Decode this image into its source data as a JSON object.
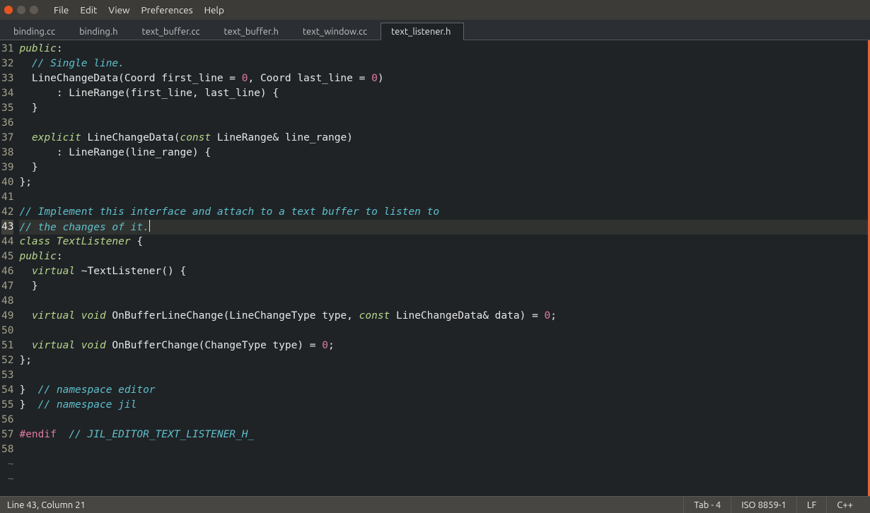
{
  "menu": [
    "File",
    "Edit",
    "View",
    "Preferences",
    "Help"
  ],
  "tabs": [
    {
      "label": "binding.cc",
      "active": false
    },
    {
      "label": "binding.h",
      "active": false
    },
    {
      "label": "text_buffer.cc",
      "active": false
    },
    {
      "label": "text_buffer.h",
      "active": false
    },
    {
      "label": "text_window.cc",
      "active": false
    },
    {
      "label": "text_listener.h",
      "active": true
    }
  ],
  "first_line_no": 31,
  "active_line_no": 43,
  "lines": [
    [
      [
        "keyword",
        "public"
      ],
      [
        "plain",
        ":"
      ]
    ],
    [
      [
        "plain",
        "  "
      ],
      [
        "comment",
        "// Single line."
      ]
    ],
    [
      [
        "plain",
        "  LineChangeData(Coord first_line = "
      ],
      [
        "number",
        "0"
      ],
      [
        "plain",
        ", Coord last_line = "
      ],
      [
        "number",
        "0"
      ],
      [
        "plain",
        ")"
      ]
    ],
    [
      [
        "plain",
        "      : LineRange(first_line, last_line) {"
      ]
    ],
    [
      [
        "plain",
        "  }"
      ]
    ],
    [],
    [
      [
        "plain",
        "  "
      ],
      [
        "keyword",
        "explicit"
      ],
      [
        "plain",
        " LineChangeData("
      ],
      [
        "keyword",
        "const"
      ],
      [
        "plain",
        " LineRange& line_range)"
      ]
    ],
    [
      [
        "plain",
        "      : LineRange(line_range) {"
      ]
    ],
    [
      [
        "plain",
        "  }"
      ]
    ],
    [
      [
        "plain",
        "};"
      ]
    ],
    [],
    [
      [
        "comment",
        "// Implement this interface and attach to a text buffer to listen to"
      ]
    ],
    [
      [
        "comment",
        "// the changes of it."
      ]
    ],
    [
      [
        "keyword",
        "class"
      ],
      [
        "plain",
        " "
      ],
      [
        "type",
        "TextListener"
      ],
      [
        "plain",
        " {"
      ]
    ],
    [
      [
        "keyword",
        "public"
      ],
      [
        "plain",
        ":"
      ]
    ],
    [
      [
        "plain",
        "  "
      ],
      [
        "keyword",
        "virtual"
      ],
      [
        "plain",
        " ~TextListener() {"
      ]
    ],
    [
      [
        "plain",
        "  }"
      ]
    ],
    [],
    [
      [
        "plain",
        "  "
      ],
      [
        "keyword",
        "virtual"
      ],
      [
        "plain",
        " "
      ],
      [
        "type",
        "void"
      ],
      [
        "plain",
        " OnBufferLineChange(LineChangeType type, "
      ],
      [
        "keyword",
        "const"
      ],
      [
        "plain",
        " LineChangeData& data) = "
      ],
      [
        "number",
        "0"
      ],
      [
        "plain",
        ";"
      ]
    ],
    [],
    [
      [
        "plain",
        "  "
      ],
      [
        "keyword",
        "virtual"
      ],
      [
        "plain",
        " "
      ],
      [
        "type",
        "void"
      ],
      [
        "plain",
        " OnBufferChange(ChangeType type) = "
      ],
      [
        "number",
        "0"
      ],
      [
        "plain",
        ";"
      ]
    ],
    [
      [
        "plain",
        "};"
      ]
    ],
    [],
    [
      [
        "plain",
        "}  "
      ],
      [
        "comment",
        "// namespace editor"
      ]
    ],
    [
      [
        "plain",
        "}  "
      ],
      [
        "comment",
        "// namespace jil"
      ]
    ],
    [],
    [
      [
        "pre",
        "#endif"
      ],
      [
        "plain",
        "  "
      ],
      [
        "comment",
        "// JIL_EDITOR_TEXT_LISTENER_H_"
      ]
    ],
    []
  ],
  "blank_tail_rows": 2,
  "cursor": {
    "line": 43,
    "after_token_index": 0
  },
  "status": {
    "pos": "Line 43, Column 21",
    "tab": "Tab - 4",
    "enc": "ISO 8859-1",
    "eol": "LF",
    "lang": "C++"
  }
}
